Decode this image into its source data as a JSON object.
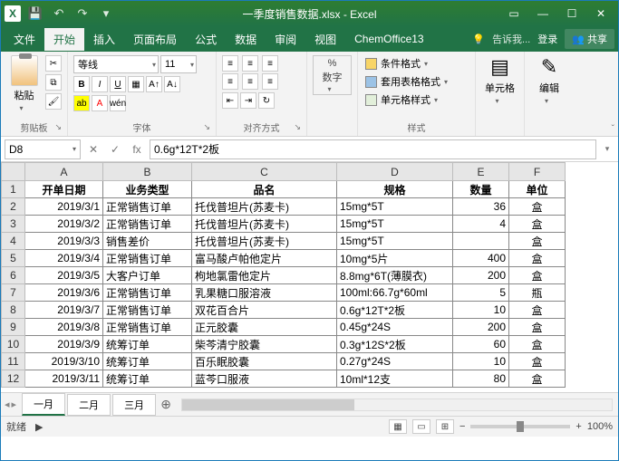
{
  "titlebar": {
    "title": "一季度销售数据.xlsx - Excel",
    "save_icon": "save-icon",
    "undo_icon": "undo-icon",
    "redo_icon": "redo-icon",
    "more_icon": "more-icon"
  },
  "menu": {
    "file": "文件",
    "home": "开始",
    "insert": "插入",
    "layout": "页面布局",
    "formulas": "公式",
    "data": "数据",
    "review": "审阅",
    "view": "视图",
    "chemoffice": "ChemOffice13",
    "tell_me": "告诉我...",
    "login": "登录",
    "share": "共享"
  },
  "ribbon": {
    "clipboard_label": "剪贴板",
    "paste": "粘贴",
    "font_label": "字体",
    "font_name": "等线",
    "font_size": "11",
    "alignment_label": "对齐方式",
    "number_label": "数字",
    "styles_label": "样式",
    "cond_fmt": "条件格式",
    "table_fmt": "套用表格格式",
    "cell_styles": "单元格样式",
    "cells_label": "单元格",
    "editing_label": "编辑"
  },
  "formula": {
    "name_box": "D8",
    "fx": "fx",
    "value": "0.6g*12T*2板"
  },
  "columns": [
    "A",
    "B",
    "C",
    "D",
    "E",
    "F"
  ],
  "headers": {
    "A": "开单日期",
    "B": "业务类型",
    "C": "品名",
    "D": "规格",
    "E": "数量",
    "F": "单位"
  },
  "rows": [
    {
      "r": 2,
      "A": "2019/3/1",
      "B": "正常销售订单",
      "C": "托伐普坦片(苏麦卡)",
      "D": "15mg*5T",
      "E": "36",
      "F": "盒"
    },
    {
      "r": 3,
      "A": "2019/3/2",
      "B": "正常销售订单",
      "C": "托伐普坦片(苏麦卡)",
      "D": "15mg*5T",
      "E": "4",
      "F": "盒"
    },
    {
      "r": 4,
      "A": "2019/3/3",
      "B": "销售差价",
      "C": "托伐普坦片(苏麦卡)",
      "D": "15mg*5T",
      "E": "",
      "F": "盒"
    },
    {
      "r": 5,
      "A": "2019/3/4",
      "B": "正常销售订单",
      "C": "富马酸卢帕他定片",
      "D": "10mg*5片",
      "E": "400",
      "F": "盒"
    },
    {
      "r": 6,
      "A": "2019/3/5",
      "B": "大客户订单",
      "C": "枸地氯雷他定片",
      "D": "8.8mg*6T(薄膜衣)",
      "E": "200",
      "F": "盒"
    },
    {
      "r": 7,
      "A": "2019/3/6",
      "B": "正常销售订单",
      "C": "乳果糖口服溶液",
      "D": "100ml:66.7g*60ml",
      "E": "5",
      "F": "瓶"
    },
    {
      "r": 8,
      "A": "2019/3/7",
      "B": "正常销售订单",
      "C": "双花百合片",
      "D": "0.6g*12T*2板",
      "E": "10",
      "F": "盒"
    },
    {
      "r": 9,
      "A": "2019/3/8",
      "B": "正常销售订单",
      "C": "正元胶囊",
      "D": "0.45g*24S",
      "E": "200",
      "F": "盒"
    },
    {
      "r": 10,
      "A": "2019/3/9",
      "B": "统筹订单",
      "C": "柴芩清宁胶囊",
      "D": "0.3g*12S*2板",
      "E": "60",
      "F": "盒"
    },
    {
      "r": 11,
      "A": "2019/3/10",
      "B": "统筹订单",
      "C": "百乐眠胶囊",
      "D": "0.27g*24S",
      "E": "10",
      "F": "盒"
    },
    {
      "r": 12,
      "A": "2019/3/11",
      "B": "统筹订单",
      "C": "蓝芩口服液",
      "D": "10ml*12支",
      "E": "80",
      "F": "盒"
    }
  ],
  "sheets": {
    "active": "一月",
    "others": [
      "二月",
      "三月"
    ]
  },
  "status": {
    "ready": "就绪",
    "zoom": "100%"
  }
}
